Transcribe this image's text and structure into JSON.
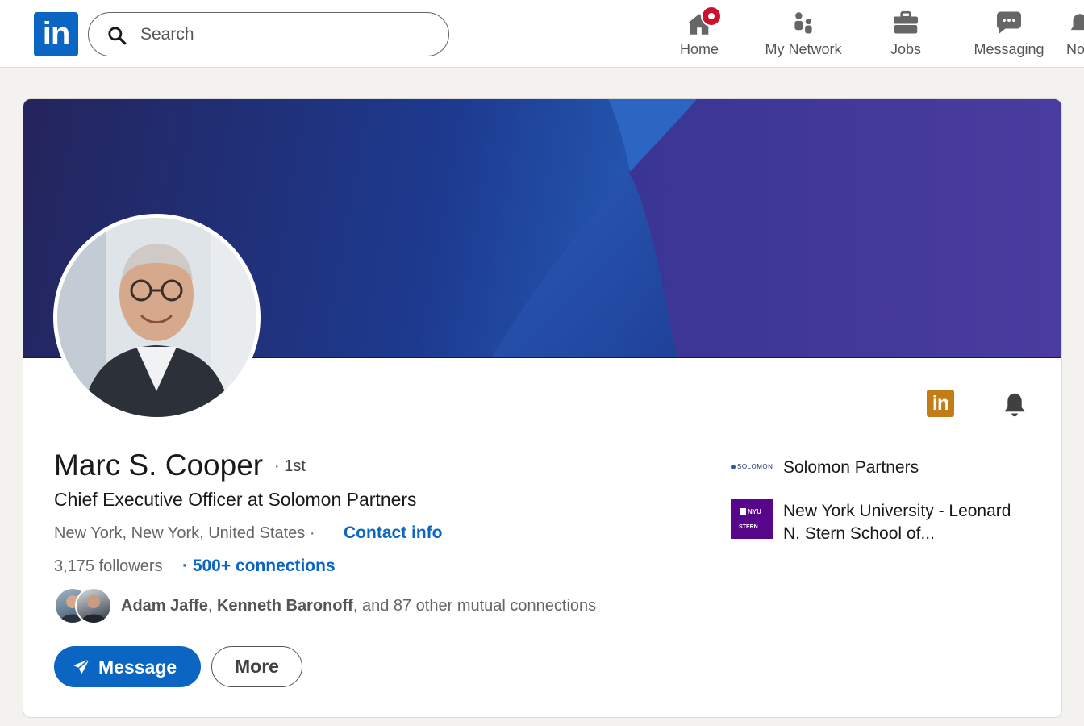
{
  "topnav": {
    "logo_text": "in",
    "search_placeholder": "Search",
    "items": [
      {
        "label": "Home",
        "icon": "home-icon"
      },
      {
        "label": "My Network",
        "icon": "people-icon"
      },
      {
        "label": "Jobs",
        "icon": "briefcase-icon"
      },
      {
        "label": "Messaging",
        "icon": "chat-icon"
      },
      {
        "label": "No",
        "icon": "bell-icon"
      }
    ],
    "home_badge": "notification-dot"
  },
  "profile": {
    "name": "Marc S. Cooper",
    "degree": "· 1st",
    "headline": "Chief Executive Officer at Solomon Partners",
    "location": "New York, New York, United States",
    "location_sep": "·",
    "contact_label": "Contact info",
    "followers": "3,175 followers",
    "connections": "· 500+ connections",
    "mutual": {
      "name1": "Adam Jaffe",
      "sep": ", ",
      "name2": "Kenneth Baronoff",
      "rest": ", and 87 other mutual connections"
    },
    "actions": {
      "message_label": "Message",
      "more_label": "More"
    },
    "badges": {
      "linkedin_icon_text": "in"
    },
    "organizations": [
      {
        "logo_text": "SOLOMON",
        "name": "Solomon Partners"
      },
      {
        "logo_text_1": "NYU",
        "logo_text_2": "STERN",
        "name": "New York University - Leonard N. Stern School of..."
      }
    ]
  },
  "colors": {
    "brand_blue": "#0a66c2",
    "notification_red": "#cb112d",
    "premium_gold": "#c37d16",
    "nyu_purple": "#57068c"
  }
}
